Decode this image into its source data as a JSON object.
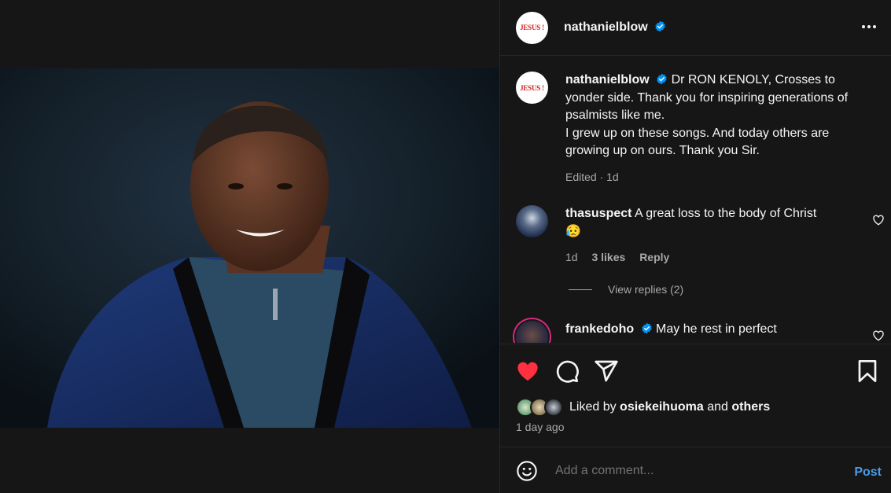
{
  "post": {
    "username": "nathanielblow",
    "avatar_text": "JESUS !",
    "caption_lines": [
      "Dr RON KENOLY, Crosses to yonder side. Thank you for inspiring generations of psalmists like me.",
      "I grew up on these songs. And today others are growing up on ours. Thank you Sir."
    ],
    "caption_meta": "Edited · 1d"
  },
  "comments": [
    {
      "username": "thasuspect",
      "text": "A great loss to the body of Christ",
      "emoji": "😥",
      "time": "1d",
      "likes": "3 likes",
      "reply": "Reply"
    },
    {
      "username": "frankedoho",
      "text": "May he rest in perfect"
    }
  ],
  "view_replies": "View replies (2)",
  "liked_by": {
    "prefix": "Liked by",
    "user": "osiekeihuoma",
    "and": "and",
    "others": "others"
  },
  "time_ago": "1 day ago",
  "comment_box": {
    "placeholder": "Add a comment...",
    "post_label": "Post"
  },
  "colors": {
    "liked_heart": "#ff3040",
    "verified": "#0095f6",
    "post_button": "#4a9be6"
  },
  "icons": [
    "more-icon",
    "heart-icon",
    "comment-icon",
    "share-icon",
    "bookmark-icon",
    "emoji-icon",
    "verified-icon"
  ]
}
